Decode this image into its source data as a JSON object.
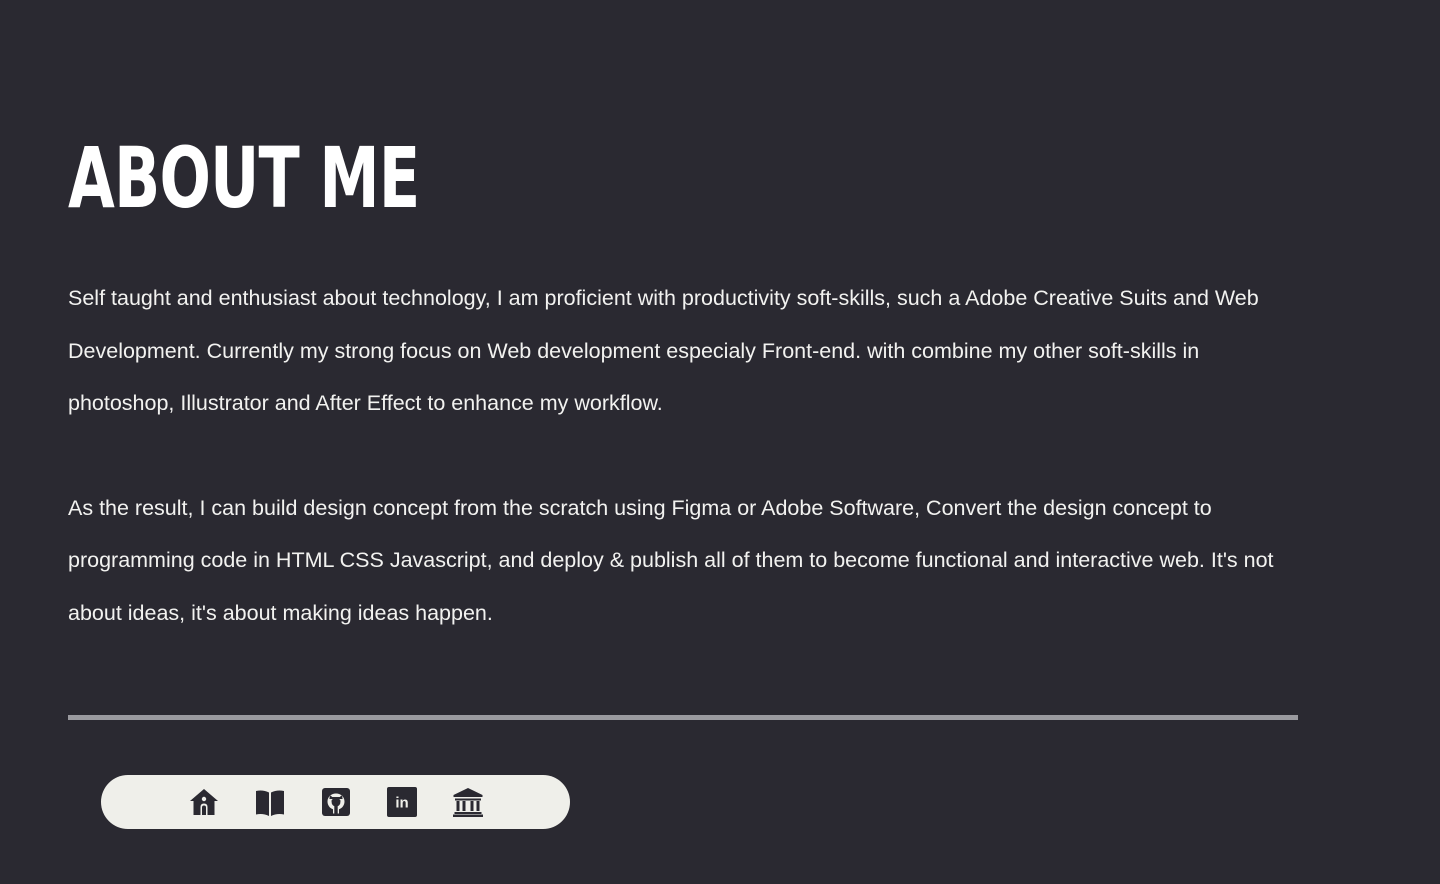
{
  "about": {
    "title": "ABOUT ME",
    "paragraphs": [
      "Self taught and enthusiast about technology, I am proficient with productivity soft-skills, such a Adobe Creative Suits and Web Development. Currently my strong focus on Web development especialy Front-end. with combine my other soft-skills in photoshop, Illustrator and After Effect to enhance my workflow.",
      "As the result, I can build design concept from the scratch using Figma or Adobe Software, Convert the design concept to programming code in HTML CSS Javascript, and deploy & publish all of them to become functional and interactive web. It's not about ideas, it's about making ideas happen."
    ]
  },
  "colors": {
    "background": "#2a2931",
    "text": "#f2f2f0",
    "divider": "#9a9a9f",
    "dock": "#efefea",
    "icon": "#2a2931"
  },
  "dock": {
    "items": [
      {
        "icon": "home-icon"
      },
      {
        "icon": "book-icon"
      },
      {
        "icon": "github-icon"
      },
      {
        "icon": "linkedin-icon",
        "text": "in"
      },
      {
        "icon": "bank-icon"
      }
    ]
  }
}
